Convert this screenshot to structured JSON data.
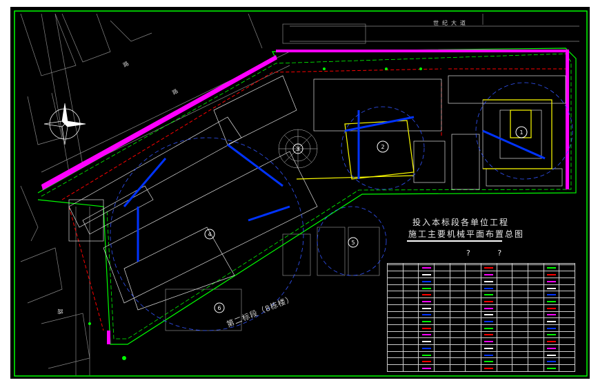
{
  "drawing": {
    "title_line1": "投入本标段各单位工程",
    "title_line2": "施工主要机械平面布置总图",
    "title_marks": "? ?",
    "road_north": "世纪大道",
    "road_northwest": "路",
    "road_west": "路",
    "road_southwest": "路",
    "area_label": "第二标段（8栋楼）"
  },
  "markers": [
    "1",
    "2",
    "3",
    "4",
    "5",
    "6"
  ],
  "legend": {
    "rows": 17,
    "columns": 12
  },
  "colors": {
    "background": "#000000",
    "page": "#ffffff",
    "frame_border": "#00ff00",
    "site_boundary": "#00ff00",
    "building_outline": "#ffffff",
    "crane_lines": "#0033ff",
    "yellow_outline": "#ffff00",
    "dashed_red": "#ff0000",
    "magenta_marks": "#ff00ff",
    "cyan_text": "#00ffff"
  }
}
